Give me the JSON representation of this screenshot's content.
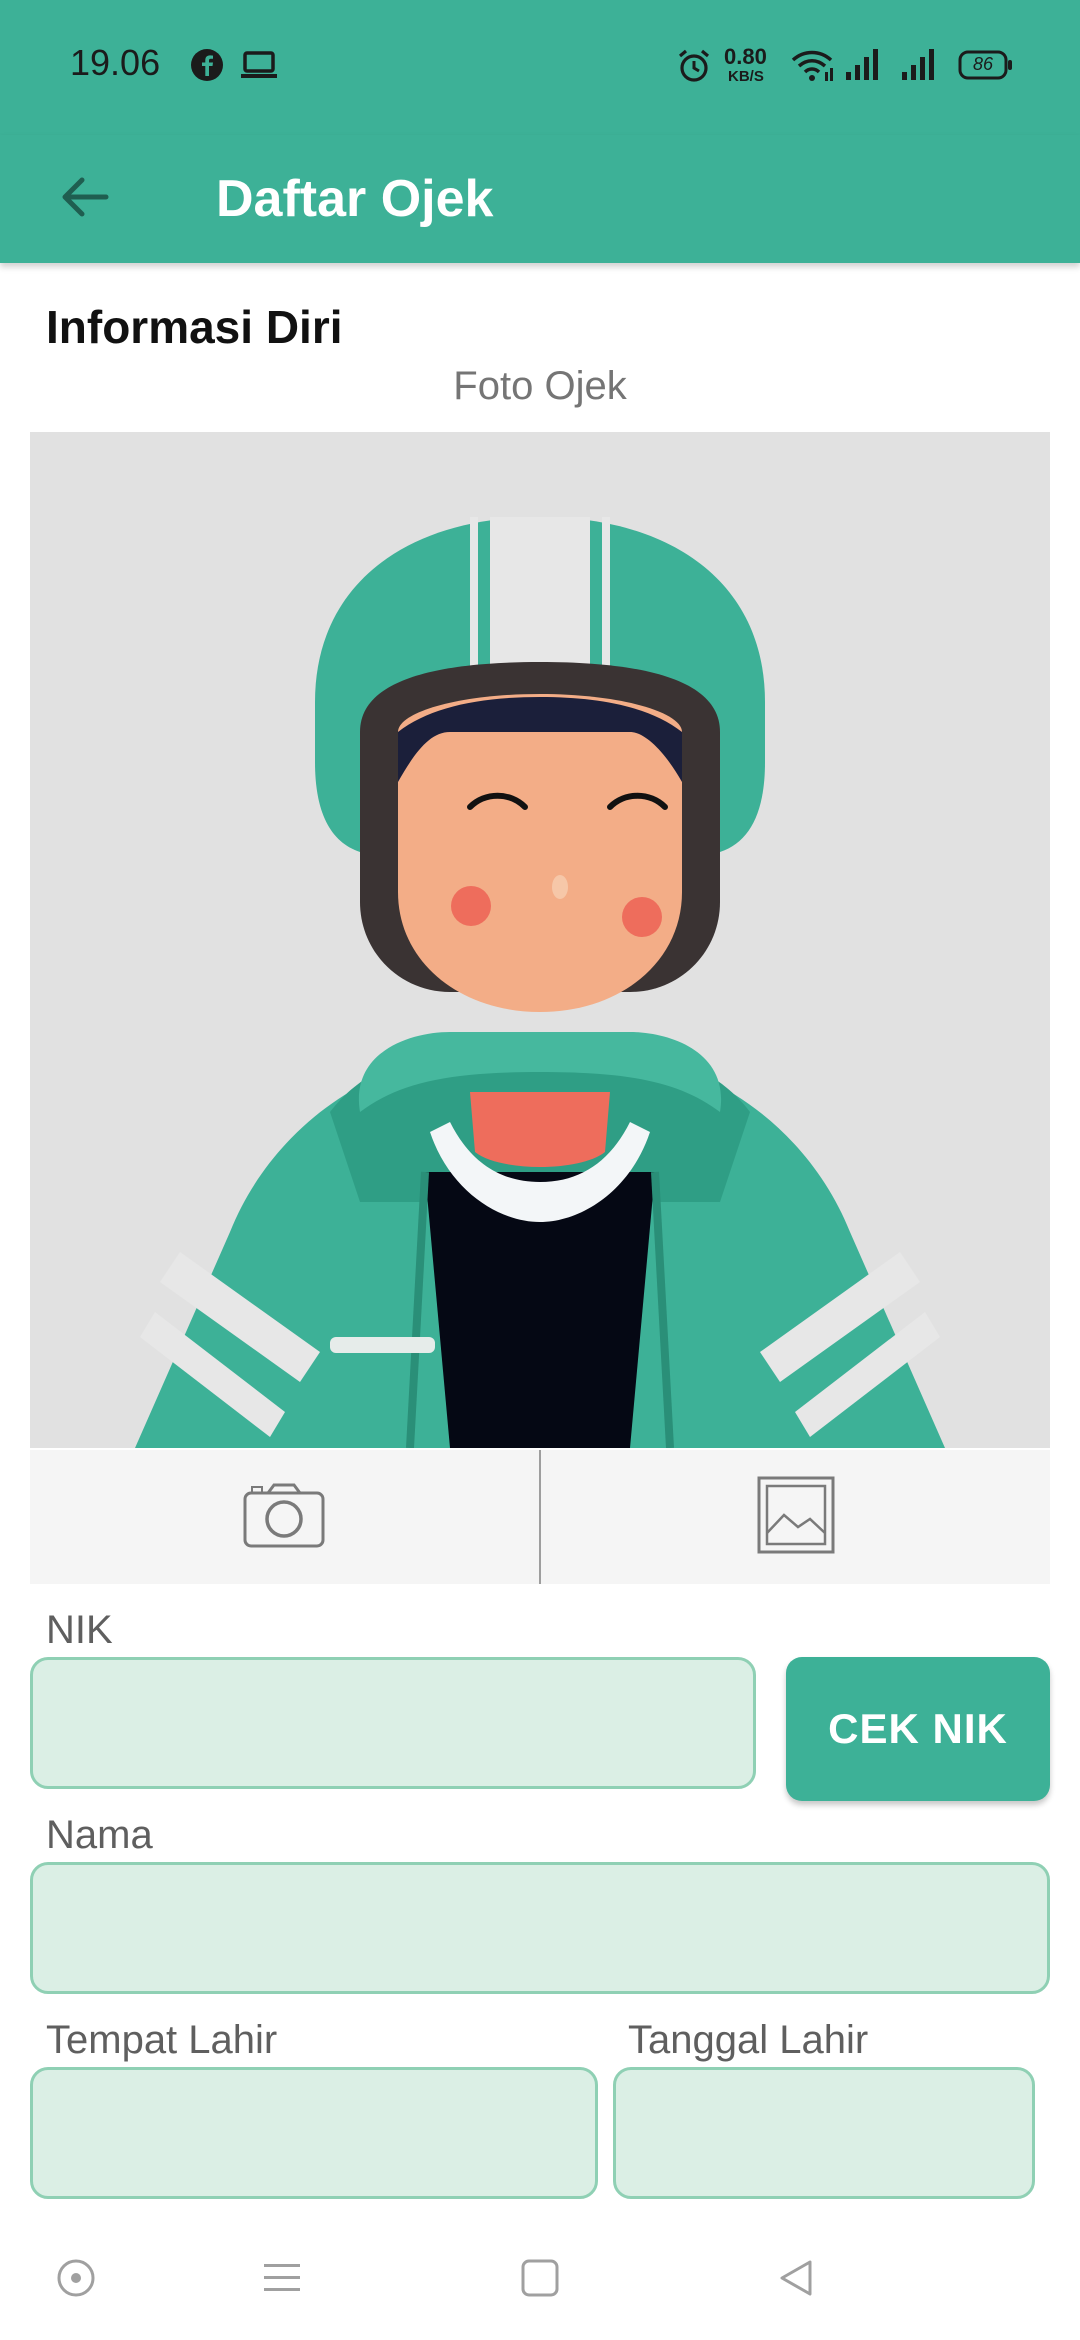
{
  "status_bar": {
    "time": "19.06",
    "net_speed_value": "0.80",
    "net_speed_unit": "KB/S",
    "battery": "86",
    "icons": [
      "facebook-icon",
      "laptop-icon",
      "alarm-icon",
      "wifi-icon",
      "signal-icon",
      "signal-icon",
      "battery-icon"
    ]
  },
  "app_bar": {
    "title": "Daftar Ojek",
    "back_icon": "arrow-left-icon"
  },
  "section": {
    "title": "Informasi Diri"
  },
  "photo": {
    "label": "Foto Ojek",
    "camera_icon": "camera-icon",
    "gallery_icon": "image-icon"
  },
  "form": {
    "nik_label": "NIK",
    "nik_value": "",
    "cek_nik_label": "CEK NIK",
    "nama_label": "Nama",
    "nama_value": "",
    "tempat_lahir_label": "Tempat Lahir",
    "tempat_lahir_value": "",
    "tanggal_lahir_label": "Tanggal Lahir",
    "tanggal_lahir_value": ""
  },
  "colors": {
    "primary": "#3db197",
    "input_bg": "#dbefe5",
    "input_border": "#8fd0b4"
  },
  "nav_bar": {
    "icons": [
      "home-circle-icon",
      "menu-icon",
      "recent-apps-icon",
      "back-triangle-icon"
    ]
  }
}
